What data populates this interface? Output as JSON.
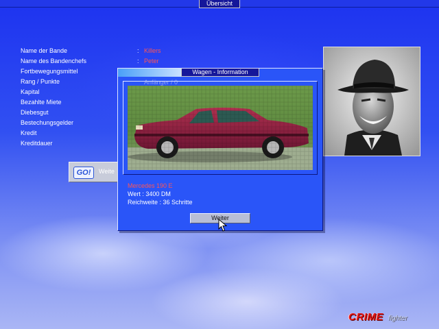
{
  "window": {
    "tab_title": "Übersicht"
  },
  "gang_info": {
    "rows": [
      {
        "label": "Name der Bande",
        "colon": ":",
        "value": "Killers"
      },
      {
        "label": "Name des Bandenchefs",
        "colon": ":",
        "value": "Peter"
      },
      {
        "label": "Fortbewegungsmittel",
        "colon": "",
        "value": ""
      },
      {
        "label": "Rang / Punkte",
        "colon": "",
        "value": ""
      },
      {
        "label": "Kapital",
        "colon": "",
        "value": ""
      },
      {
        "label": "Bezahlte Miete",
        "colon": "",
        "value": ""
      },
      {
        "label": "Diebesgut",
        "colon": "",
        "value": ""
      },
      {
        "label": "Bestechungsgelder",
        "colon": "",
        "value": ""
      },
      {
        "label": "Kredit",
        "colon": "",
        "value": ""
      },
      {
        "label": "Kreditdauer",
        "colon": "",
        "value": ""
      }
    ]
  },
  "go_button": {
    "logo": "GO!",
    "label": "Weite"
  },
  "dialog": {
    "title": "Wagen - Information",
    "underlying_text": "Anfänger / 0",
    "car_name": "Mercedes 190 E",
    "value_line": "Wert : 3400 DM",
    "range_line": "Reichweite : 36 Schritte",
    "button_label": "Weiter"
  },
  "logo": {
    "main": "CRIME",
    "sub": "fighter"
  },
  "colors": {
    "accent_red": "#ff5555",
    "panel_blue": "#2a55f8",
    "title_bar": "#15179a"
  },
  "icons": [
    "mouse-cursor-icon",
    "go-logo-icon"
  ]
}
